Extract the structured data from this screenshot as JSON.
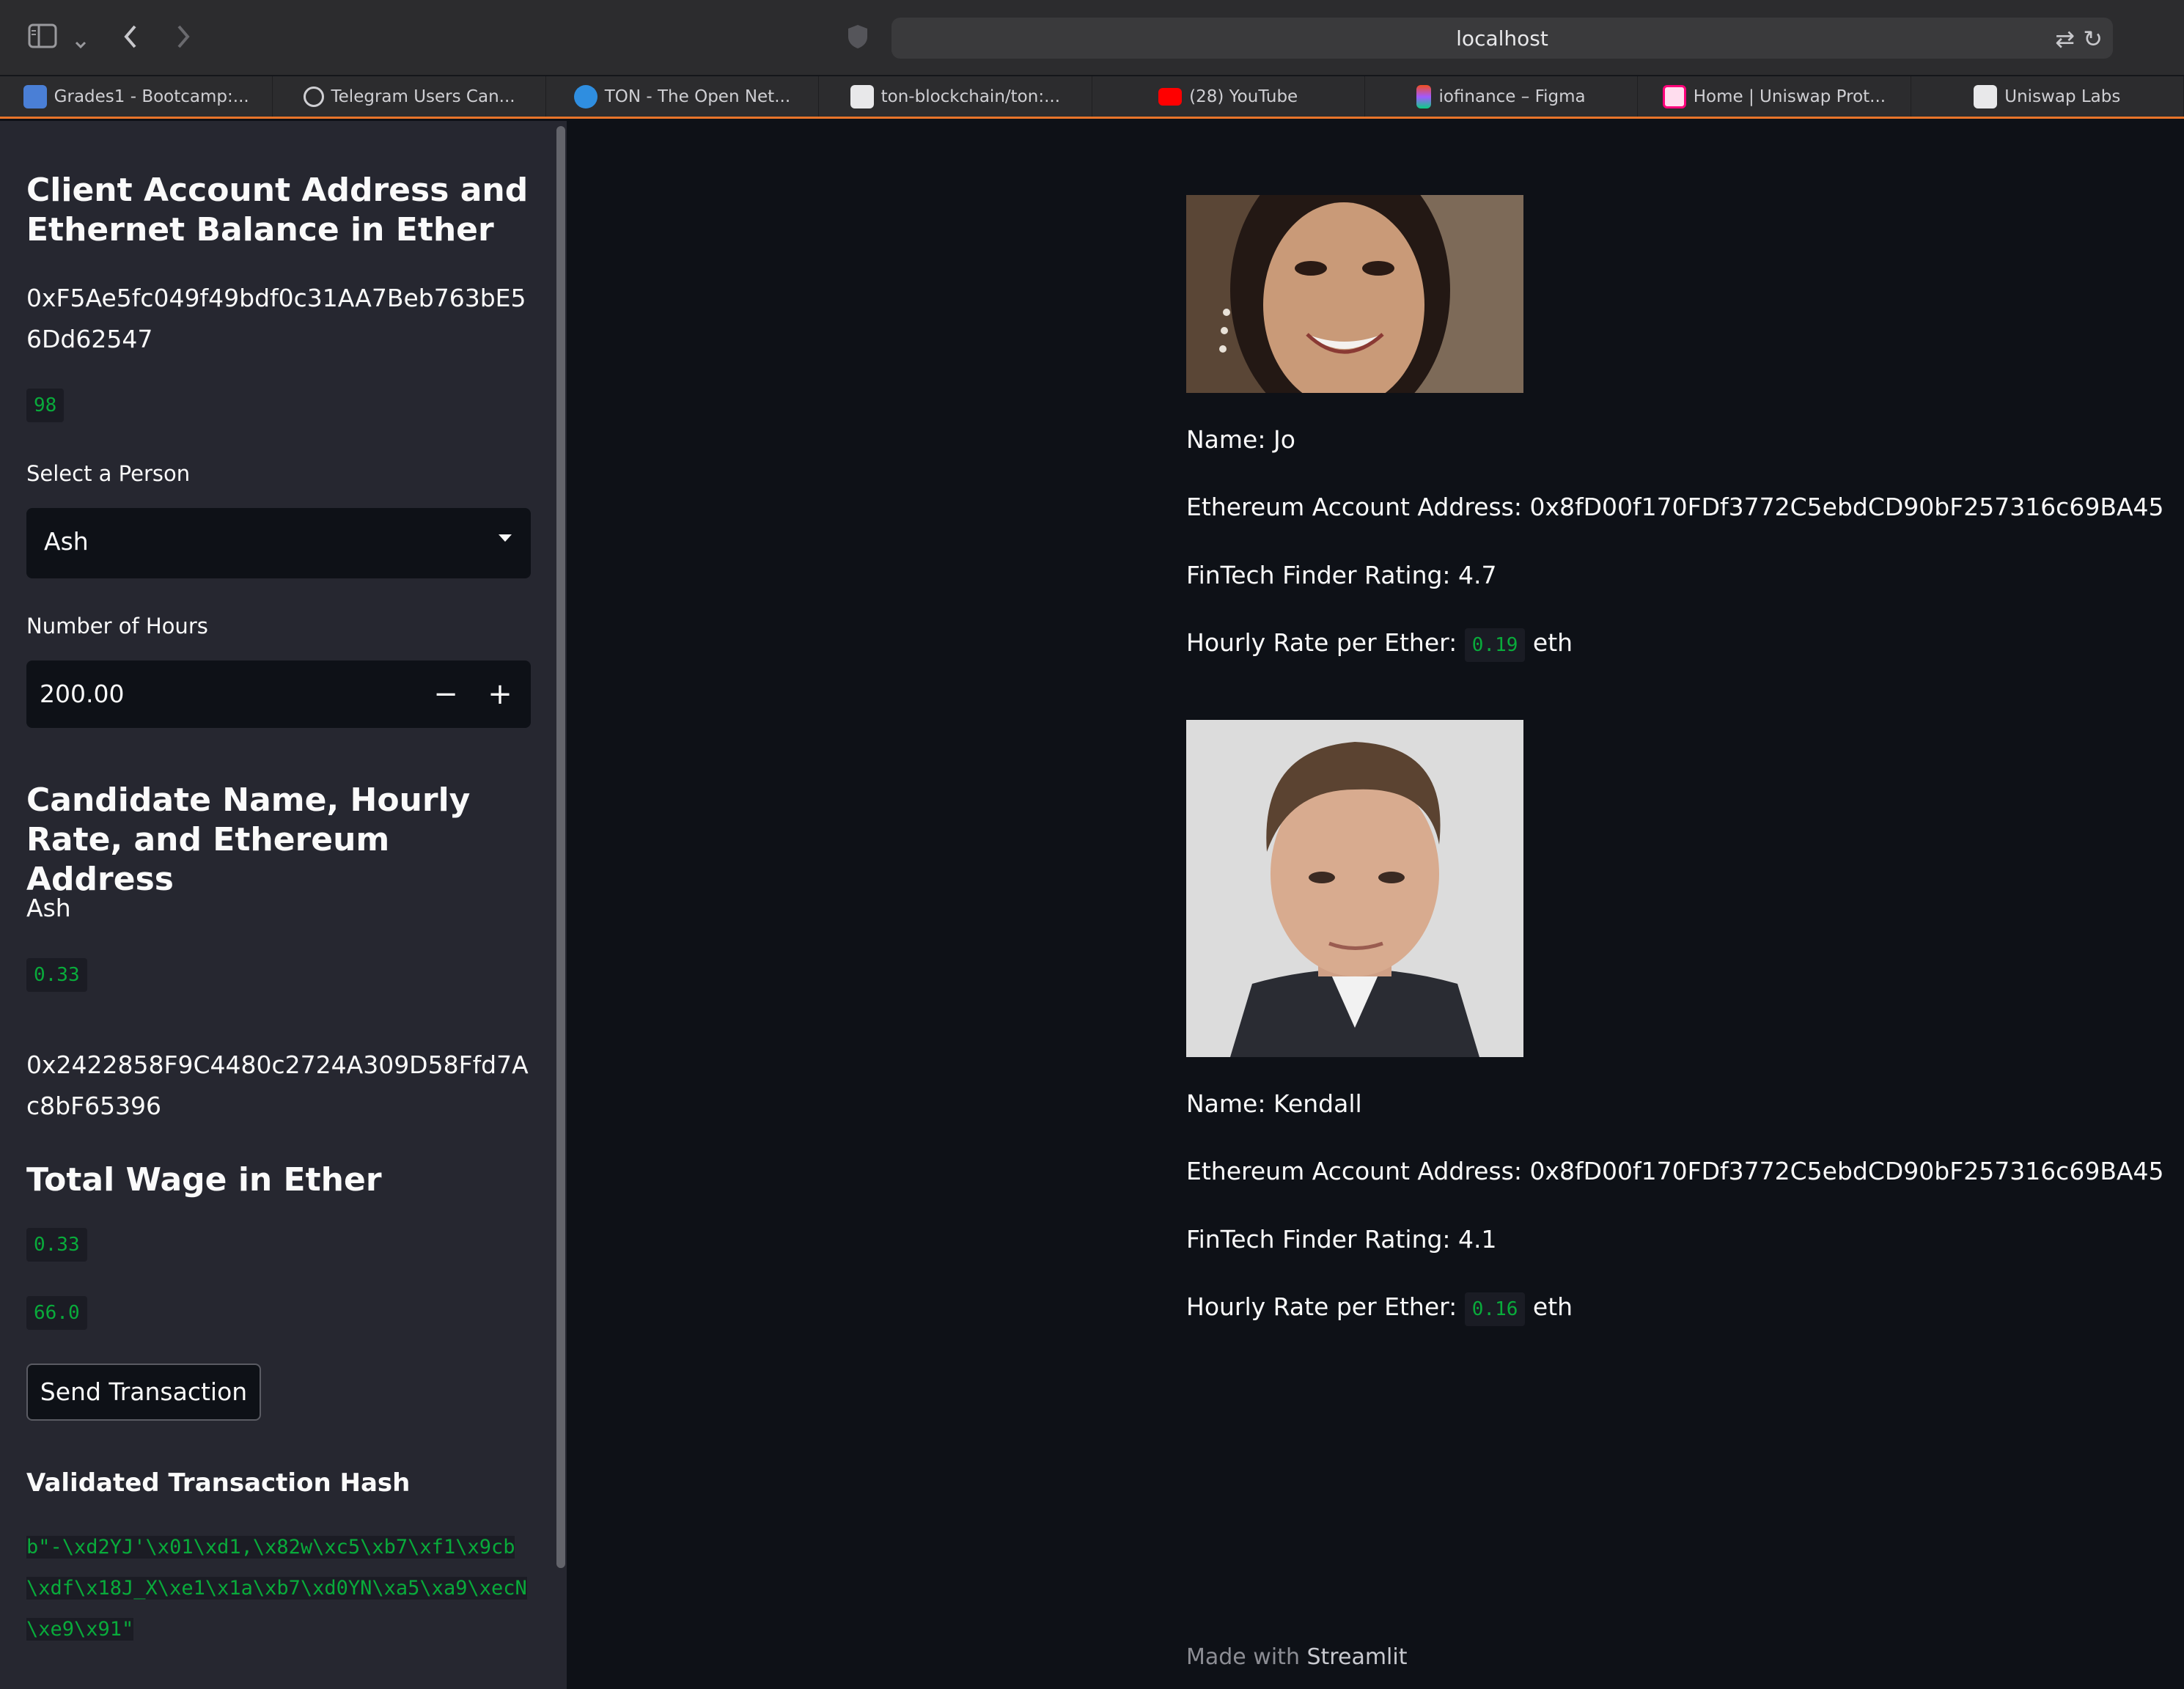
{
  "browser": {
    "url": "localhost",
    "tabs": [
      {
        "title": "Grades1 - Bootcamp:...",
        "favicon": "bootcamp-logo-icon",
        "color": "#4a7fd6"
      },
      {
        "title": "Telegram Users Can...",
        "favicon": "at-sign-icon",
        "color": "#cfcfd3"
      },
      {
        "title": "TON - The Open Net...",
        "favicon": "ton-logo-icon",
        "color": "#2f8ee0"
      },
      {
        "title": "ton-blockchain/ton:...",
        "favicon": "github-icon",
        "color": "#e8e8ea"
      },
      {
        "title": "(28) YouTube",
        "favicon": "youtube-icon",
        "color": "#ff0000"
      },
      {
        "title": "iofinance – Figma",
        "favicon": "figma-icon",
        "color": "#a259ff"
      },
      {
        "title": "Home | Uniswap Prot...",
        "favicon": "uniswap-icon",
        "color": "#ff007a"
      },
      {
        "title": "Uniswap Labs",
        "favicon": "github-icon",
        "color": "#e8e8ea"
      }
    ]
  },
  "sidebar": {
    "client_header": "Client Account Address and Ethernet Balance in Ether",
    "client_address": "0xF5Ae5fc049f49bdf0c31AA7Beb763bE56Dd62547",
    "client_balance": "98",
    "select_label": "Select a Person",
    "select_value": "Ash",
    "hours_label": "Number of Hours",
    "hours_value": "200.00",
    "candidate_header": "Candidate Name, Hourly Rate, and Ethereum Address",
    "candidate_name": "Ash",
    "candidate_rate": "0.33",
    "candidate_address": "0x2422858F9C4480c2724A309D58Ffd7Ac8bF65396",
    "wage_header": "Total Wage in Ether",
    "wage_rate": "0.33",
    "wage_total": "66.0",
    "send_button": "Send Transaction",
    "hash_header": "Validated Transaction Hash",
    "hash_value": "b\"-\\xd2YJ'\\x01\\xd1,\\x82w\\xc5\\xb7\\xf1\\x9cb\\xdf\\x18J_X\\xe1\\x1a\\xb7\\xd0YN\\xa5\\xa9\\xecN\\xe9\\x91\""
  },
  "candidates": [
    {
      "name": "Name: Jo",
      "address": "Ethereum Account Address: 0x8fD00f170FDf3772C5ebdCD90bF257316c69BA45",
      "rating": "FinTech Finder Rating: 4.7",
      "rate_label": "Hourly Rate per Ether:",
      "rate_value": "0.19",
      "rate_unit": "eth"
    },
    {
      "name": "Name: Kendall",
      "address": "Ethereum Account Address: 0x8fD00f170FDf3772C5ebdCD90bF257316c69BA45",
      "rating": "FinTech Finder Rating: 4.1",
      "rate_label": "Hourly Rate per Ether:",
      "rate_value": "0.16",
      "rate_unit": "eth"
    }
  ],
  "footer": {
    "prefix": "Made with",
    "brand": "Streamlit"
  },
  "colors": {
    "accent": "#09ab3b",
    "sidebar_bg": "#262730",
    "main_bg": "#0e1117",
    "tab_underline": "#e8742a"
  }
}
